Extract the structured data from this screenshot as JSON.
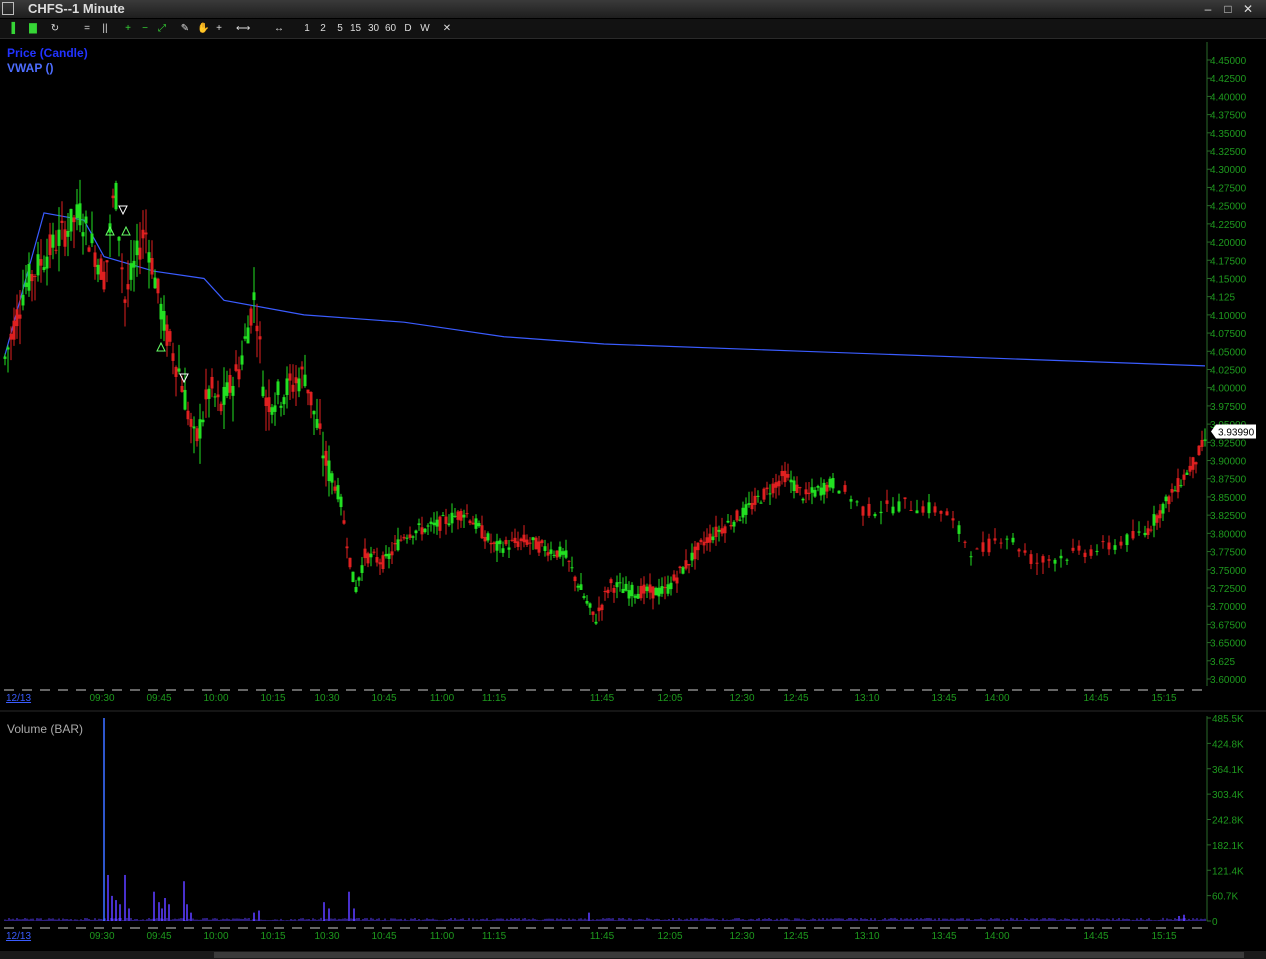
{
  "window": {
    "title": "CHFS--1 Minute"
  },
  "window_controls": {
    "minimize": "–",
    "maximize": "□",
    "close": "✕"
  },
  "toolbar": {
    "items": [
      {
        "name": "chart-type-icon",
        "label": "▌"
      },
      {
        "name": "indicator-icon",
        "label": "▇"
      },
      {
        "name": "refresh-icon",
        "label": "↻"
      },
      {
        "name": "lines-icon",
        "label": "="
      },
      {
        "name": "bars-icon",
        "label": "||"
      },
      {
        "name": "zoom-in-icon",
        "label": "+"
      },
      {
        "name": "zoom-out-icon",
        "label": "−"
      },
      {
        "name": "fit-icon",
        "label": "⤢"
      },
      {
        "name": "draw-icon",
        "label": "✎"
      },
      {
        "name": "hand-icon",
        "label": "✋"
      },
      {
        "name": "crosshair-icon",
        "label": "+"
      },
      {
        "name": "line-style-icon",
        "label": "⟷"
      },
      {
        "name": "scroll-icon",
        "label": "↔"
      }
    ],
    "intervals": [
      "1",
      "2",
      "5",
      "15",
      "30",
      "60",
      "D",
      "W"
    ],
    "close_label": "✕"
  },
  "panes": {
    "price_legend": [
      "Price (Candle)",
      "VWAP ()"
    ],
    "volume_legend": "Volume (BAR)"
  },
  "current_price_tag": "3.93990",
  "date_label": "12/13",
  "colors": {
    "up": "#22e022",
    "down": "#e02020",
    "vwap": "#3a5cff",
    "axis_text": "#1e9a1e",
    "volume": "#5a3cff",
    "legend_price": "#2233ff",
    "legend_vwap": "#4d6dff"
  },
  "chart_data": [
    {
      "type": "candlestick",
      "title": "Price (Candle)",
      "ylim": [
        3.6,
        4.46
      ],
      "yticks": [
        "4.45000",
        "4.42500",
        "4.40000",
        "4.37500",
        "4.35000",
        "4.32500",
        "4.30000",
        "4.27500",
        "4.25000",
        "4.22500",
        "4.20000",
        "4.17500",
        "4.15000",
        "4.125",
        "4.10000",
        "4.07500",
        "4.05000",
        "4.02500",
        "4.00000",
        "3.97500",
        "3.95000",
        "3.92500",
        "3.90000",
        "3.87500",
        "3.85000",
        "3.82500",
        "3.80000",
        "3.77500",
        "3.75000",
        "3.72500",
        "3.70000",
        "3.67500",
        "3.65000",
        "3.625",
        "3.60000"
      ],
      "xticks": [
        "09:30",
        "09:45",
        "10:00",
        "10:15",
        "10:30",
        "10:45",
        "11:00",
        "11:15",
        "11:45",
        "12:05",
        "12:30",
        "12:45",
        "13:10",
        "13:45",
        "14:00",
        "14:45",
        "15:15"
      ],
      "vwap": [
        [
          0,
          4.04
        ],
        [
          40,
          4.24
        ],
        [
          80,
          4.23
        ],
        [
          100,
          4.18
        ],
        [
          150,
          4.16
        ],
        [
          200,
          4.15
        ],
        [
          220,
          4.12
        ],
        [
          300,
          4.1
        ],
        [
          400,
          4.09
        ],
        [
          450,
          4.08
        ],
        [
          500,
          4.07
        ],
        [
          600,
          4.06
        ],
        [
          800,
          4.05
        ],
        [
          1000,
          4.04
        ],
        [
          1201,
          4.03
        ]
      ]
    },
    {
      "type": "bar",
      "title": "Volume (BAR)",
      "ylim": [
        0,
        485000
      ],
      "yticks": [
        "485.5K",
        "424.8K",
        "364.1K",
        "303.4K",
        "242.8K",
        "182.1K",
        "121.4K",
        "60.7K",
        "0"
      ],
      "xticks": [
        "09:30",
        "09:45",
        "10:00",
        "10:15",
        "10:30",
        "10:45",
        "11:00",
        "11:15",
        "11:45",
        "12:05",
        "12:30",
        "12:45",
        "13:10",
        "13:45",
        "14:00",
        "14:45",
        "15:15"
      ],
      "spikes": [
        [
          100,
          485000
        ],
        [
          104,
          110000
        ],
        [
          108,
          60000
        ],
        [
          112,
          50000
        ],
        [
          116,
          40000
        ],
        [
          121,
          110000
        ],
        [
          125,
          30000
        ],
        [
          150,
          70000
        ],
        [
          155,
          45000
        ],
        [
          158,
          30000
        ],
        [
          161,
          55000
        ],
        [
          165,
          40000
        ],
        [
          180,
          95000
        ],
        [
          183,
          40000
        ],
        [
          187,
          20000
        ],
        [
          250,
          20000
        ],
        [
          255,
          25000
        ],
        [
          320,
          45000
        ],
        [
          325,
          30000
        ],
        [
          345,
          70000
        ],
        [
          350,
          30000
        ],
        [
          585,
          20000
        ],
        [
          1175,
          12000
        ],
        [
          1180,
          15000
        ]
      ]
    }
  ]
}
